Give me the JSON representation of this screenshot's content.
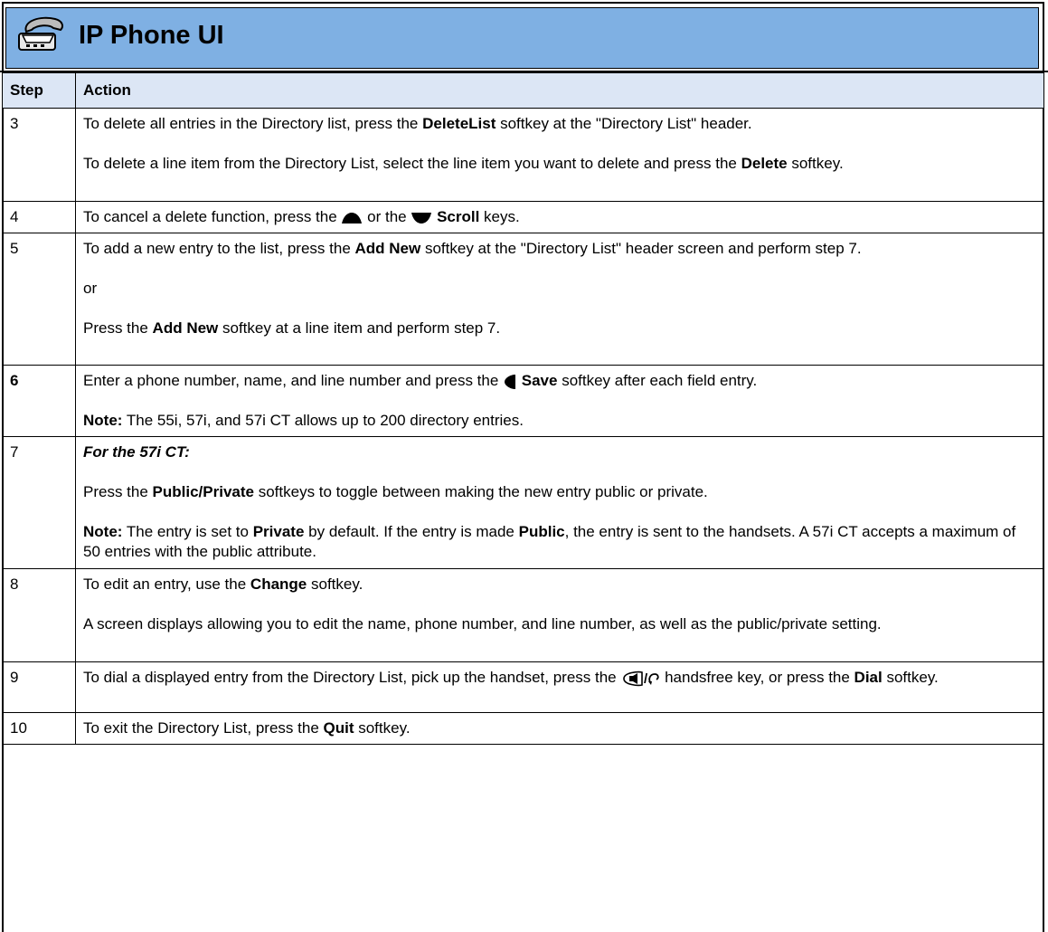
{
  "header": {
    "title": "IP Phone UI",
    "icon": "phone-icon",
    "banner_color": "#7fb0e3"
  },
  "table": {
    "columns": [
      "Step",
      "Action"
    ],
    "header_color": "#dce6f5",
    "rows": [
      {
        "step": "3",
        "s1_pre": "To delete all entries in the Directory list, press the ",
        "s1_b1": "DeleteList",
        "s1_post": " softkey at the \"Directory List\" header.",
        "s2_pre": "To delete a line item from the Directory List, select the line item you want to delete and press the ",
        "s2_b1": "Delete",
        "s2_post": " softkey."
      },
      {
        "step": "4",
        "s1_pre": "To cancel a delete function, press the ",
        "icon_up": "scroll-up-icon",
        "s1_mid": " or the ",
        "icon_down": "scroll-down-icon",
        "s1_b1": "Scroll",
        "s1_post": " keys."
      },
      {
        "step": "5",
        "s1_pre": "To add a new entry to the list, press the ",
        "s1_b1": "Add New",
        "s1_post": " softkey at the \"Directory List\" header screen and perform step 7.",
        "s2": "or",
        "s3_pre": "Press the ",
        "s3_b1": "Add New",
        "s3_post": " softkey at a line item and perform step 7."
      },
      {
        "step": "6",
        "s1_pre": "Enter a phone number, name, and line number and press the ",
        "icon_left": "left-arrow-icon",
        "s1_b1": "Save",
        "s1_post": " softkey after each field entry.",
        "s2_b1": "Note:",
        "s2_post": " The 55i, 57i, and 57i CT allows up to 200 directory entries."
      },
      {
        "step": "7",
        "s1": "For the 57i CT:",
        "s2_pre": "Press the ",
        "s2_b1": "Public/Private",
        "s2_post": " softkeys to toggle between making the new entry public or private.",
        "s3_b1": "Note:",
        "s3_t1": " The entry is set to ",
        "s3_b2": "Private",
        "s3_t2": " by default. If the entry is made ",
        "s3_b3": "Public",
        "s3_t3": ", the entry is sent to the handsets. A 57i CT accepts a maximum of 50 entries with the public attribute."
      },
      {
        "step": "8",
        "s1_pre": "To edit an entry, use the ",
        "s1_b1": "Change",
        "s1_post": " softkey.",
        "s2": "A screen displays allowing you to edit the name, phone number, and line number, as well as the public/private setting."
      },
      {
        "step": "9",
        "s1_pre": "To dial a displayed entry from the Directory List, pick up the handset, press the ",
        "icon_handsfree": "handsfree-icon",
        "s1_mid": " handsfree key, or press the ",
        "s1_b1": "Dial",
        "s1_post": " softkey."
      },
      {
        "step": "10",
        "s1_pre": "To exit the Directory List, press the ",
        "s1_b1": "Quit",
        "s1_post": " softkey."
      }
    ]
  }
}
